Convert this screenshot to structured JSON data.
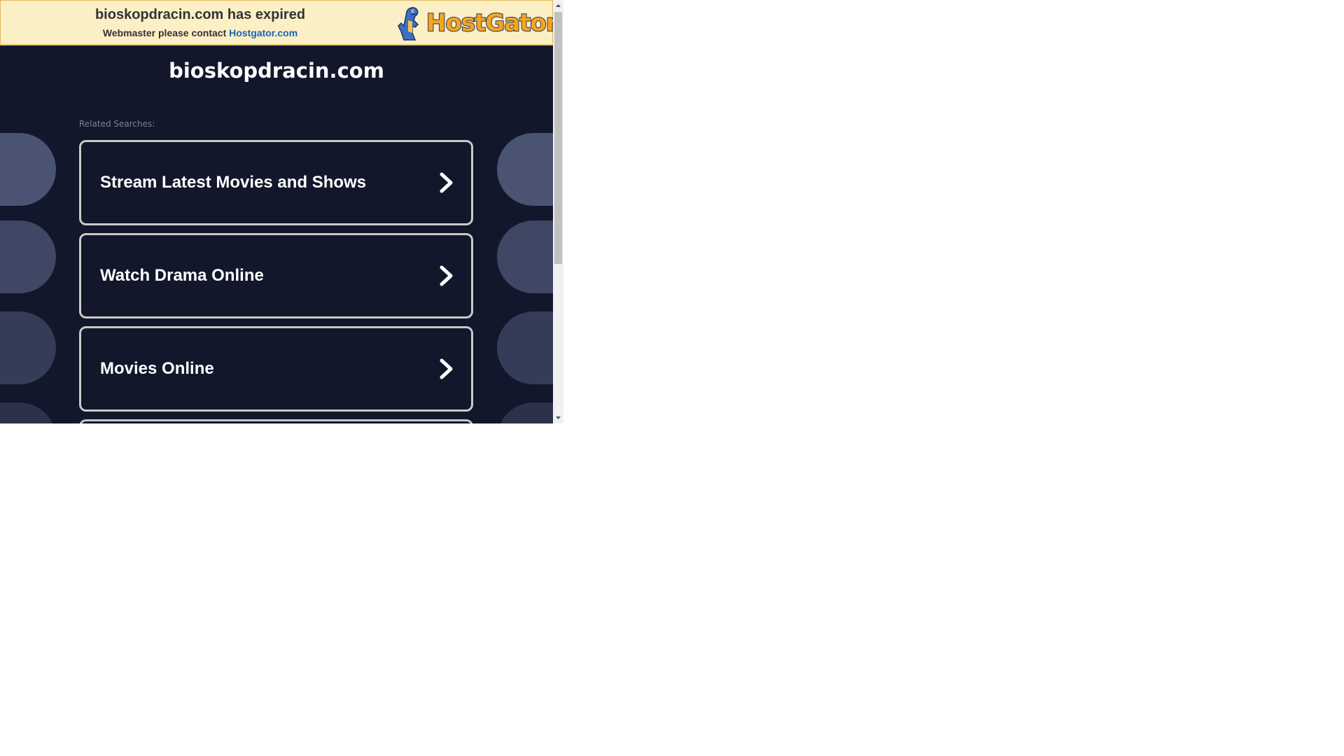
{
  "banner": {
    "title": "bioskopdracin.com has expired",
    "contact_prefix": "Webmaster please contact ",
    "contact_link": "Hostgator.com",
    "logo_text": "HostGator",
    "colors": {
      "background": "#fbefc6",
      "border": "#e0b65a",
      "link": "#1565b8",
      "logo_fill": "#f6a51c",
      "logo_outline": "#243b6a"
    }
  },
  "main": {
    "domain": "bioskopdracin.com",
    "related_label": "Related Searches:",
    "results": [
      {
        "label": "Stream Latest Movies and Shows",
        "icon": "chevron-right-icon"
      },
      {
        "label": "Watch Drama Online",
        "icon": "chevron-right-icon"
      },
      {
        "label": "Movies Online",
        "icon": "chevron-right-icon"
      }
    ],
    "colors": {
      "background": "#12172b",
      "tile_border": "#c9c9c9",
      "text": "#ffffff",
      "muted": "#7b8091"
    }
  },
  "scrollbar": {
    "up_icon": "scroll-up-arrow-icon",
    "down_icon": "scroll-down-arrow-icon"
  }
}
